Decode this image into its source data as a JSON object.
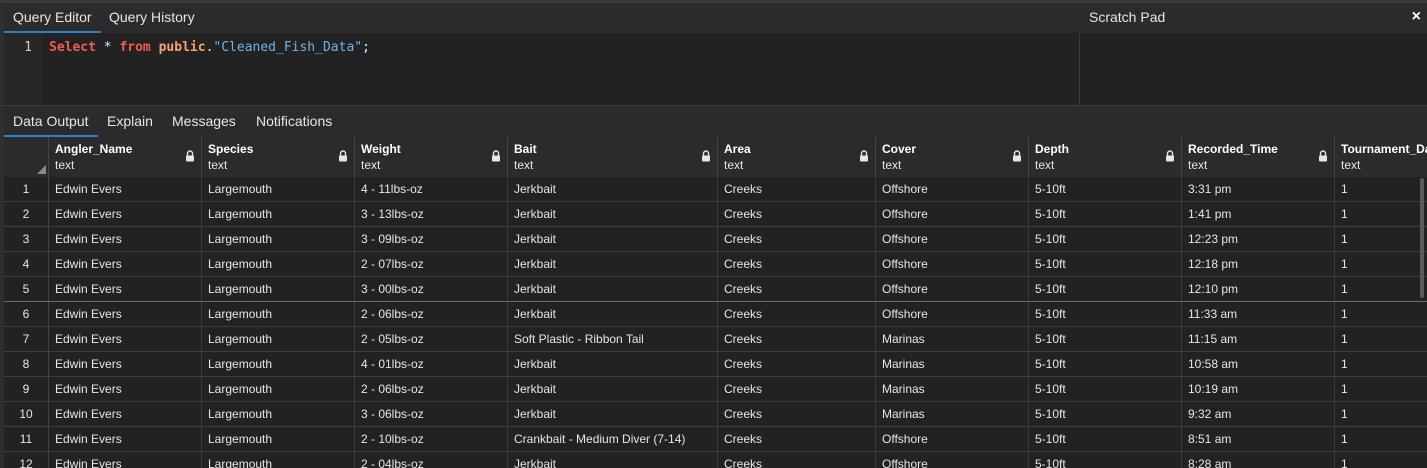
{
  "query_tabs": [
    {
      "label": "Query Editor",
      "active": true
    },
    {
      "label": "Query History",
      "active": false
    }
  ],
  "scratch_pad": {
    "title": "Scratch Pad",
    "close_icon": "×"
  },
  "editor": {
    "line_number": "1",
    "tokens": {
      "select": "Select",
      "star": " * ",
      "from": "from",
      "space": " ",
      "schema": "public",
      "dot": ".",
      "table": "\"Cleaned_Fish_Data\"",
      "semicolon": ";"
    }
  },
  "result_tabs": [
    {
      "label": "Data Output",
      "active": true
    },
    {
      "label": "Explain",
      "active": false
    },
    {
      "label": "Messages",
      "active": false
    },
    {
      "label": "Notifications",
      "active": false
    }
  ],
  "columns": [
    {
      "name": "Angler_Name",
      "type": "text"
    },
    {
      "name": "Species",
      "type": "text"
    },
    {
      "name": "Weight",
      "type": "text"
    },
    {
      "name": "Bait",
      "type": "text"
    },
    {
      "name": "Area",
      "type": "text"
    },
    {
      "name": "Cover",
      "type": "text"
    },
    {
      "name": "Depth",
      "type": "text"
    },
    {
      "name": "Recorded_Time",
      "type": "text"
    },
    {
      "name": "Tournament_Day",
      "type": "text"
    }
  ],
  "rows": [
    {
      "n": "1",
      "cells": [
        "Edwin Evers",
        "Largemouth",
        "4 - 11lbs-oz",
        "Jerkbait",
        "Creeks",
        "Offshore",
        "5-10ft",
        "3:31 pm",
        "1"
      ]
    },
    {
      "n": "2",
      "cells": [
        "Edwin Evers",
        "Largemouth",
        "3 - 13lbs-oz",
        "Jerkbait",
        "Creeks",
        "Offshore",
        "5-10ft",
        "1:41 pm",
        "1"
      ]
    },
    {
      "n": "3",
      "cells": [
        "Edwin Evers",
        "Largemouth",
        "3 - 09lbs-oz",
        "Jerkbait",
        "Creeks",
        "Offshore",
        "5-10ft",
        "12:23 pm",
        "1"
      ]
    },
    {
      "n": "4",
      "cells": [
        "Edwin Evers",
        "Largemouth",
        "2 - 07lbs-oz",
        "Jerkbait",
        "Creeks",
        "Offshore",
        "5-10ft",
        "12:18 pm",
        "1"
      ]
    },
    {
      "n": "5",
      "cells": [
        "Edwin Evers",
        "Largemouth",
        "3 - 00lbs-oz",
        "Jerkbait",
        "Creeks",
        "Offshore",
        "5-10ft",
        "12:10 pm",
        "1"
      ]
    },
    {
      "n": "6",
      "cells": [
        "Edwin Evers",
        "Largemouth",
        "2 - 06lbs-oz",
        "Jerkbait",
        "Creeks",
        "Offshore",
        "5-10ft",
        "11:33 am",
        "1"
      ]
    },
    {
      "n": "7",
      "cells": [
        "Edwin Evers",
        "Largemouth",
        "2 - 05lbs-oz",
        "Soft Plastic - Ribbon Tail",
        "Creeks",
        "Marinas",
        "5-10ft",
        "11:15 am",
        "1"
      ]
    },
    {
      "n": "8",
      "cells": [
        "Edwin Evers",
        "Largemouth",
        "4 - 01lbs-oz",
        "Jerkbait",
        "Creeks",
        "Marinas",
        "5-10ft",
        "10:58 am",
        "1"
      ]
    },
    {
      "n": "9",
      "cells": [
        "Edwin Evers",
        "Largemouth",
        "2 - 06lbs-oz",
        "Jerkbait",
        "Creeks",
        "Marinas",
        "5-10ft",
        "10:19 am",
        "1"
      ]
    },
    {
      "n": "10",
      "cells": [
        "Edwin Evers",
        "Largemouth",
        "3 - 06lbs-oz",
        "Jerkbait",
        "Creeks",
        "Marinas",
        "5-10ft",
        "9:32 am",
        "1"
      ]
    },
    {
      "n": "11",
      "cells": [
        "Edwin Evers",
        "Largemouth",
        "2 - 10lbs-oz",
        "Crankbait - Medium Diver (7-14)",
        "Creeks",
        "Offshore",
        "5-10ft",
        "8:51 am",
        "1"
      ]
    },
    {
      "n": "12",
      "cells": [
        "Edwin Evers",
        "Largemouth",
        "2 - 04lbs-oz",
        "Jerkbait",
        "Creeks",
        "Offshore",
        "5-10ft",
        "8:28 am",
        "1"
      ]
    }
  ],
  "colors": {
    "active_tab_underline": "#2b7fd3",
    "keyword": "#f25c54",
    "schema": "#f7a072",
    "string": "#6fb2ec",
    "background": "#222222"
  },
  "icons": {
    "column_lock": "lock-icon",
    "grid_corner": "select-all-triangle-icon"
  }
}
